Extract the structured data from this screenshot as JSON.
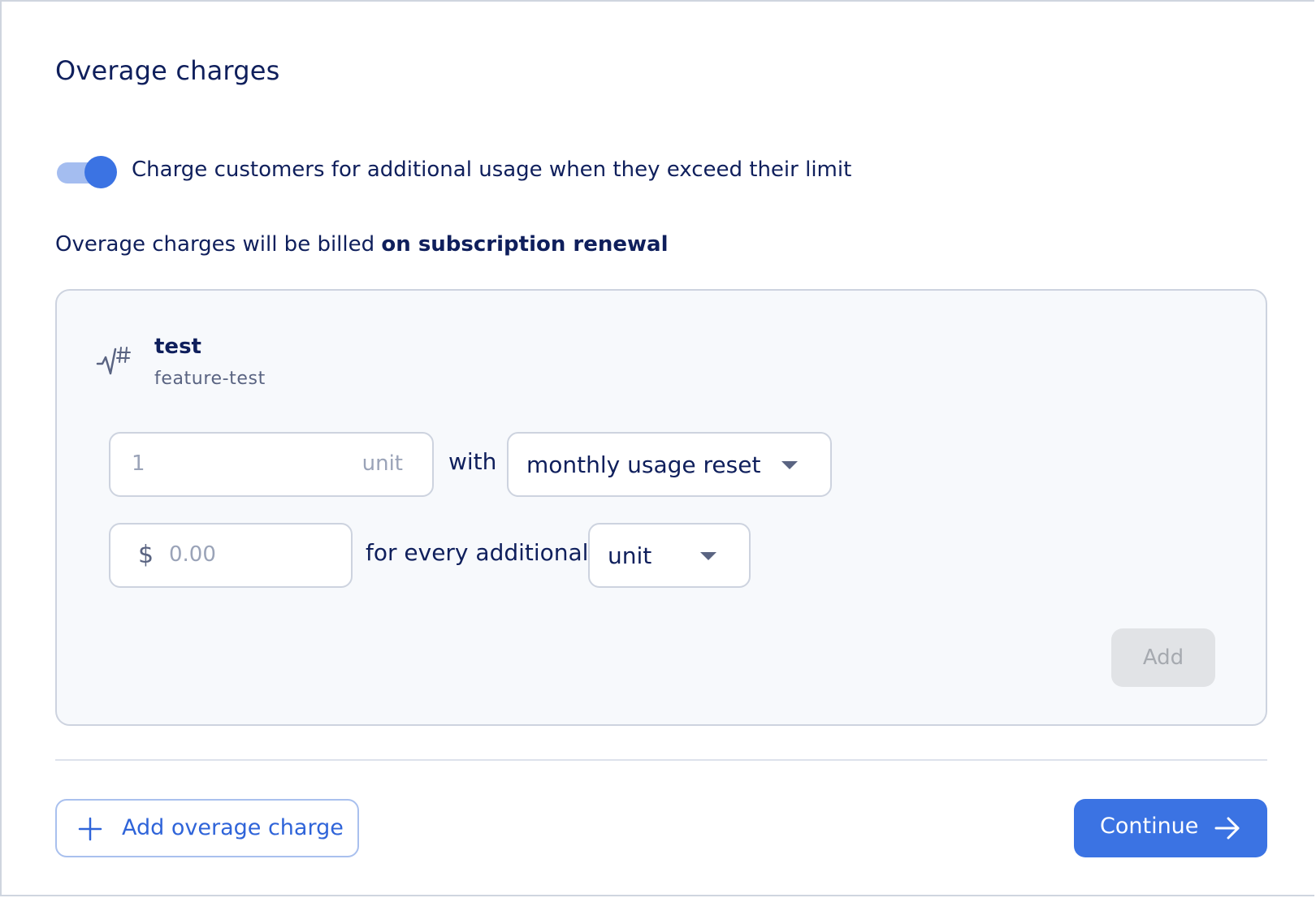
{
  "section": {
    "title": "Overage charges",
    "toggle_label": "Charge customers for additional usage when they exceed their limit",
    "toggle_on": true,
    "billing_note_prefix": "Overage charges will be billed ",
    "billing_note_bold": "on subscription renewal"
  },
  "feature": {
    "name": "test",
    "id": "feature-test",
    "icon": "usage-metric-icon"
  },
  "form": {
    "units_value": "1",
    "units_suffix": "unit",
    "with_text": "with",
    "reset_select": "monthly usage reset",
    "currency": "$",
    "price_placeholder": "0.00",
    "for_every_text": "for every additional",
    "unit_select": "unit",
    "add_label": "Add"
  },
  "footer": {
    "add_overage_label": "Add overage charge",
    "continue_label": "Continue"
  },
  "colors": {
    "primary": "#3b73e3",
    "text": "#0f1f5c",
    "disabled_bg": "#e1e3e6"
  }
}
